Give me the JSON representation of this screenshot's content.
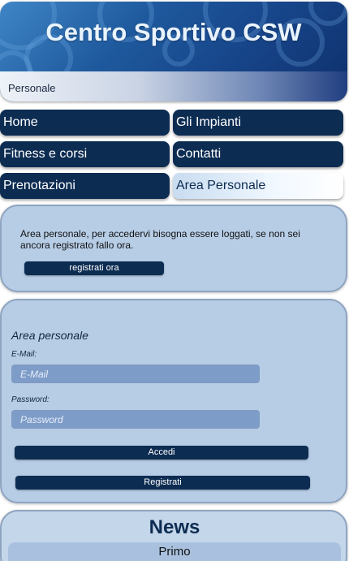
{
  "header": {
    "title": "Centro Sportivo CSW",
    "breadcrumb": "Personale"
  },
  "nav": {
    "items": [
      {
        "label": "Home",
        "active": false
      },
      {
        "label": "Gli Impianti",
        "active": false
      },
      {
        "label": "Fitness e corsi",
        "active": false
      },
      {
        "label": "Contatti",
        "active": false
      },
      {
        "label": "Prenotazioni",
        "active": false
      },
      {
        "label": "Area Personale",
        "active": true
      }
    ]
  },
  "intro": {
    "text": "Area personale, per accedervi bisogna essere loggati, se non sei ancora registrato fallo ora.",
    "register_button": "registrati ora"
  },
  "login": {
    "title": "Area personale",
    "email_label": "E-Mail:",
    "email_placeholder": "E-Mail",
    "email_value": "",
    "password_label": "Password:",
    "password_placeholder": "Password",
    "password_value": "",
    "login_button": "Accedi",
    "register_button": "Registrati"
  },
  "news": {
    "title": "News",
    "items": [
      "Primo"
    ]
  },
  "colors": {
    "nav_background": "#0d2c52",
    "panel_background": "#b7cde6",
    "header_dark": "#0e2f6a"
  }
}
